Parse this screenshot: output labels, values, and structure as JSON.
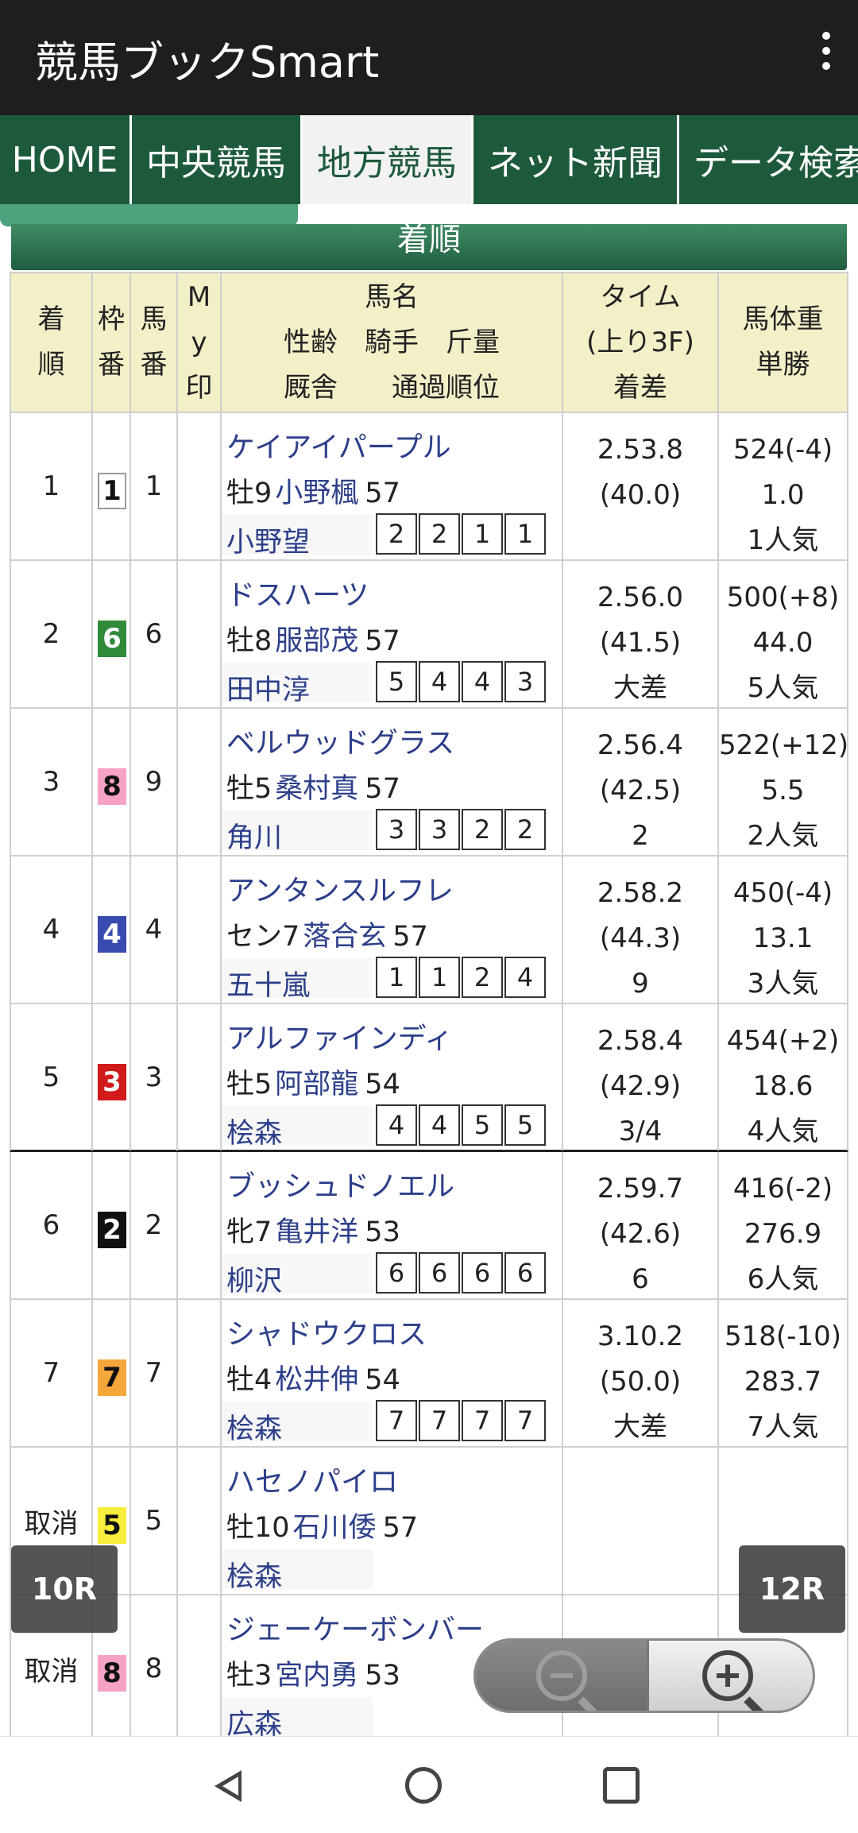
{
  "app": {
    "title": "競馬ブックSmart",
    "menu_icon": "more-vert-icon"
  },
  "tabs": [
    {
      "label": "HOME",
      "active": false
    },
    {
      "label": "中央競馬",
      "active": false
    },
    {
      "label": "地方競馬",
      "active": true
    },
    {
      "label": "ネット新聞",
      "active": false
    },
    {
      "label": "データ検索",
      "active": false
    }
  ],
  "section": {
    "title": "着順"
  },
  "table_header": {
    "rank": [
      "着",
      "順"
    ],
    "waku": [
      "枠",
      "番"
    ],
    "uma": [
      "馬",
      "番"
    ],
    "my": [
      "M",
      "y",
      "印"
    ],
    "horse": [
      "馬名",
      "性齢　騎手　斤量",
      "厩舎　　通過順位"
    ],
    "time": [
      "タイム",
      "(上り3F)",
      "着差"
    ],
    "weight": [
      "馬体重",
      "単勝"
    ]
  },
  "rows": [
    {
      "rank": "1",
      "waku": "1",
      "waku_color": "#ffffff",
      "waku_text": "#111111",
      "uma": "1",
      "name": "ケイアイパープル",
      "sexage": "牡9",
      "jockey": "小野楓",
      "weight_carried": "57",
      "trainer": "小野望",
      "passing": [
        "2",
        "2",
        "1",
        "1"
      ],
      "time": "2.53.8",
      "last3f": "(40.0)",
      "margin": "",
      "body_weight": "524(-4)",
      "odds": "1.0",
      "popularity": "1人気"
    },
    {
      "rank": "2",
      "waku": "6",
      "waku_color": "#2f8a3a",
      "waku_text": "#ffffff",
      "uma": "6",
      "name": "ドスハーツ",
      "sexage": "牡8",
      "jockey": "服部茂",
      "weight_carried": "57",
      "trainer": "田中淳",
      "passing": [
        "5",
        "4",
        "4",
        "3"
      ],
      "time": "2.56.0",
      "last3f": "(41.5)",
      "margin": "大差",
      "body_weight": "500(+8)",
      "odds": "44.0",
      "popularity": "5人気"
    },
    {
      "rank": "3",
      "waku": "8",
      "waku_color": "#f6a2c4",
      "waku_text": "#111111",
      "uma": "9",
      "name": "ベルウッドグラス",
      "sexage": "牡5",
      "jockey": "桑村真",
      "weight_carried": "57",
      "trainer": "角川",
      "passing": [
        "3",
        "3",
        "2",
        "2"
      ],
      "time": "2.56.4",
      "last3f": "(42.5)",
      "margin": "2",
      "body_weight": "522(+12)",
      "odds": "5.5",
      "popularity": "2人気"
    },
    {
      "rank": "4",
      "waku": "4",
      "waku_color": "#3a4bb0",
      "waku_text": "#ffffff",
      "uma": "4",
      "name": "アンタンスルフレ",
      "sexage": "セン7",
      "jockey": "落合玄",
      "weight_carried": "57",
      "trainer": "五十嵐",
      "passing": [
        "1",
        "1",
        "2",
        "4"
      ],
      "time": "2.58.2",
      "last3f": "(44.3)",
      "margin": "9",
      "body_weight": "450(-4)",
      "odds": "13.1",
      "popularity": "3人気"
    },
    {
      "rank": "5",
      "waku": "3",
      "waku_color": "#d11a1a",
      "waku_text": "#ffffff",
      "uma": "3",
      "name": "アルファインディ",
      "sexage": "牡5",
      "jockey": "阿部龍",
      "weight_carried": "54",
      "trainer": "桧森",
      "passing": [
        "4",
        "4",
        "5",
        "5"
      ],
      "time": "2.58.4",
      "last3f": "(42.9)",
      "margin": "3/4",
      "body_weight": "454(+2)",
      "odds": "18.6",
      "popularity": "4人気"
    },
    {
      "rank": "6",
      "waku": "2",
      "waku_color": "#111111",
      "waku_text": "#ffffff",
      "uma": "2",
      "name": "ブッシュドノエル",
      "sexage": "牝7",
      "jockey": "亀井洋",
      "weight_carried": "53",
      "trainer": "柳沢",
      "passing": [
        "6",
        "6",
        "6",
        "6"
      ],
      "time": "2.59.7",
      "last3f": "(42.6)",
      "margin": "6",
      "body_weight": "416(-2)",
      "odds": "276.9",
      "popularity": "6人気"
    },
    {
      "rank": "7",
      "waku": "7",
      "waku_color": "#f5a63a",
      "waku_text": "#111111",
      "uma": "7",
      "name": "シャドウクロス",
      "sexage": "牡4",
      "jockey": "松井伸",
      "weight_carried": "54",
      "trainer": "桧森",
      "passing": [
        "7",
        "7",
        "7",
        "7"
      ],
      "time": "3.10.2",
      "last3f": "(50.0)",
      "margin": "大差",
      "body_weight": "518(-10)",
      "odds": "283.7",
      "popularity": "7人気"
    },
    {
      "rank": "取消",
      "waku": "5",
      "waku_color": "#f8ee3c",
      "waku_text": "#111111",
      "uma": "5",
      "name": "ハセノパイロ",
      "sexage": "牡10",
      "jockey": "石川倭",
      "weight_carried": "57",
      "trainer": "桧森",
      "passing": [],
      "time": "",
      "last3f": "",
      "margin": "",
      "body_weight": "",
      "odds": "",
      "popularity": ""
    },
    {
      "rank": "取消",
      "waku": "8",
      "waku_color": "#f6a2c4",
      "waku_text": "#111111",
      "uma": "8",
      "name": "ジェーケーボンバー",
      "sexage": "牡3",
      "jockey": "宮内勇",
      "weight_carried": "53",
      "trainer": "広森",
      "passing": [],
      "time": "",
      "last3f": "",
      "margin": "",
      "body_weight": "",
      "odds": "",
      "popularity": ""
    }
  ],
  "float": {
    "prev_race": "10R",
    "next_race": "12R",
    "zoom_out_icon": "zoom-out-icon",
    "zoom_in_icon": "zoom-in-icon"
  },
  "navbar": {
    "back_icon": "back-icon",
    "home_icon": "home-icon",
    "recents_icon": "recents-icon"
  }
}
